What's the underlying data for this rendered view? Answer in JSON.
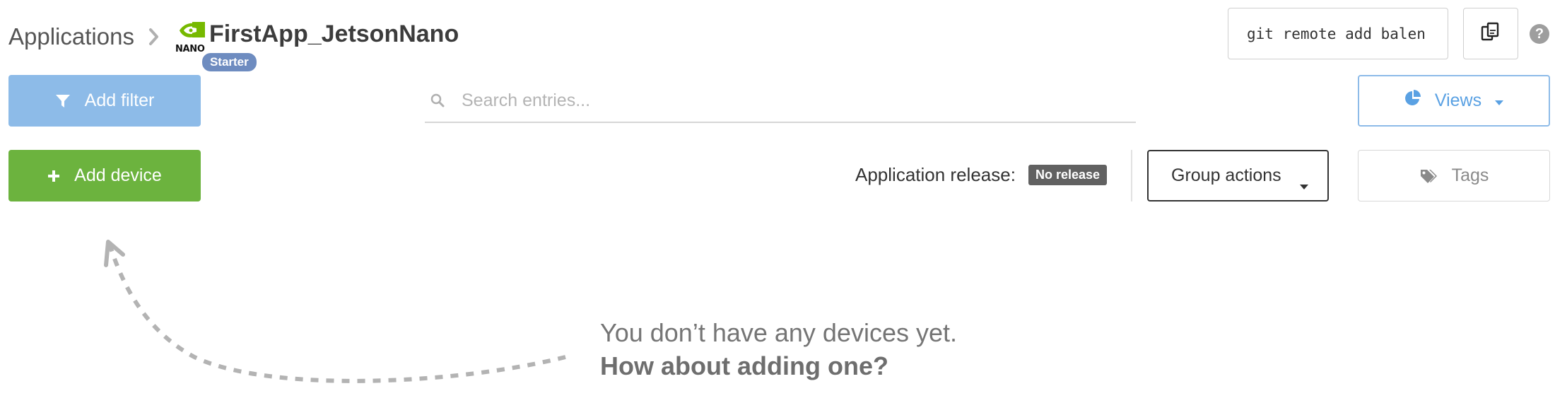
{
  "header": {
    "breadcrumb_root": "Applications",
    "device_badge_text": "NANO",
    "app_name": "FirstApp_JetsonNano",
    "tier_badge": "Starter",
    "git_command": "git remote add balen"
  },
  "toolbar": {
    "add_filter_label": "Add filter",
    "add_device_label": "Add device",
    "search_placeholder": "Search entries...",
    "views_label": "Views",
    "release_label": "Application release:",
    "release_badge": "No release",
    "group_actions_label": "Group actions",
    "tags_label": "Tags"
  },
  "empty_state": {
    "line1": "You don’t have any devices yet.",
    "line2": "How about adding one?"
  },
  "icons": {
    "breadcrumb_separator": "chevron-right-icon",
    "device_logo": "nvidia-nano-icon",
    "copy": "copy-icon",
    "help": "help-icon",
    "filter": "filter-icon",
    "add": "plus-icon",
    "search": "search-icon",
    "views": "pie-chart-icon",
    "dropdown": "caret-down-icon",
    "tags": "tags-icon"
  },
  "colors": {
    "add_device_green": "#6cb33e",
    "add_filter_blue": "#8dbbe8",
    "views_blue": "#5aa1e3",
    "starter_badge": "#6e8cc0",
    "release_badge": "#616161",
    "nvidia_green": "#76b900"
  }
}
